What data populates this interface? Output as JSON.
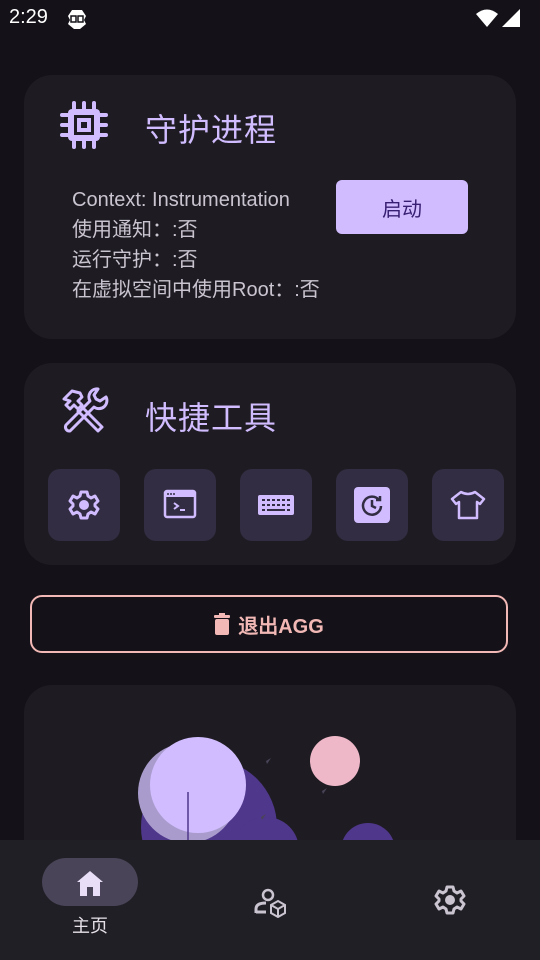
{
  "status_bar": {
    "time": "2:29",
    "app_icon": "gameguardian-icon",
    "wifi_icon": "wifi-icon",
    "signal_icon": "signal-icon"
  },
  "daemon_card": {
    "icon": "chip-icon",
    "title": "守护进程",
    "lines": [
      "Context: Instrumentation",
      "使用通知：:否",
      "运行守护：:否",
      "在虚拟空间中使用Root：:否"
    ],
    "start_button": "启动"
  },
  "tools_card": {
    "icon": "tools-icon",
    "title": "快捷工具",
    "tools": [
      {
        "name": "settings",
        "icon": "gear-icon"
      },
      {
        "name": "terminal",
        "icon": "terminal-icon"
      },
      {
        "name": "keyboard",
        "icon": "keyboard-icon"
      },
      {
        "name": "history",
        "icon": "history-icon"
      },
      {
        "name": "theme",
        "icon": "tshirt-icon"
      }
    ]
  },
  "exit_button": {
    "icon": "trash-icon",
    "label": "退出AGG"
  },
  "bottom_nav": {
    "items": [
      {
        "label": "主页",
        "icon": "home-icon",
        "active": true
      },
      {
        "label": "",
        "icon": "user-box-icon",
        "active": false
      },
      {
        "label": "",
        "icon": "gear-icon",
        "active": false
      }
    ]
  },
  "colors": {
    "background": "#141218",
    "card": "#1e1c22",
    "primary": "#d0bcff",
    "on_primary": "#381e72",
    "error": "#f2b8b5",
    "tool_bg": "#322d42",
    "nav_bg": "#211f26",
    "nav_pill": "#4a4458"
  }
}
